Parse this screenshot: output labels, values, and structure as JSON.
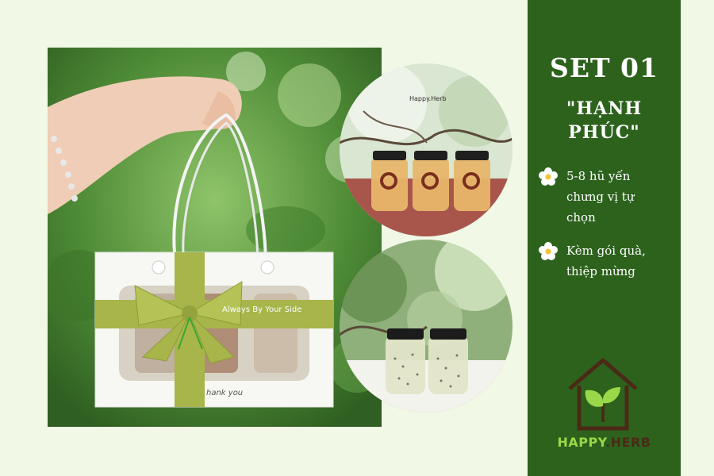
{
  "panel": {
    "title": "SET 01",
    "subtitle_line1": "\"HẠNH",
    "subtitle_line2": "PHÚC\"",
    "features": [
      {
        "icon": "flower-icon",
        "lines": [
          "5-8 hũ yến",
          "chưng vị tự",
          "chọn"
        ]
      },
      {
        "icon": "flower-icon",
        "lines": [
          "Kèm gói quà,",
          "thiệp mừng"
        ]
      }
    ]
  },
  "brand": {
    "happy": "HAPPY",
    "herb": ".HERB"
  },
  "photo": {
    "ribbon_text": "Always By Your Side",
    "thank_you": "hank you",
    "jar_label": "Happy.Herb"
  },
  "colors": {
    "background": "#f1f8e6",
    "panel": "#2d621d",
    "accent_green": "#9ad84a",
    "brand_brown": "#4a2a16",
    "ribbon": "#a7b54a"
  }
}
